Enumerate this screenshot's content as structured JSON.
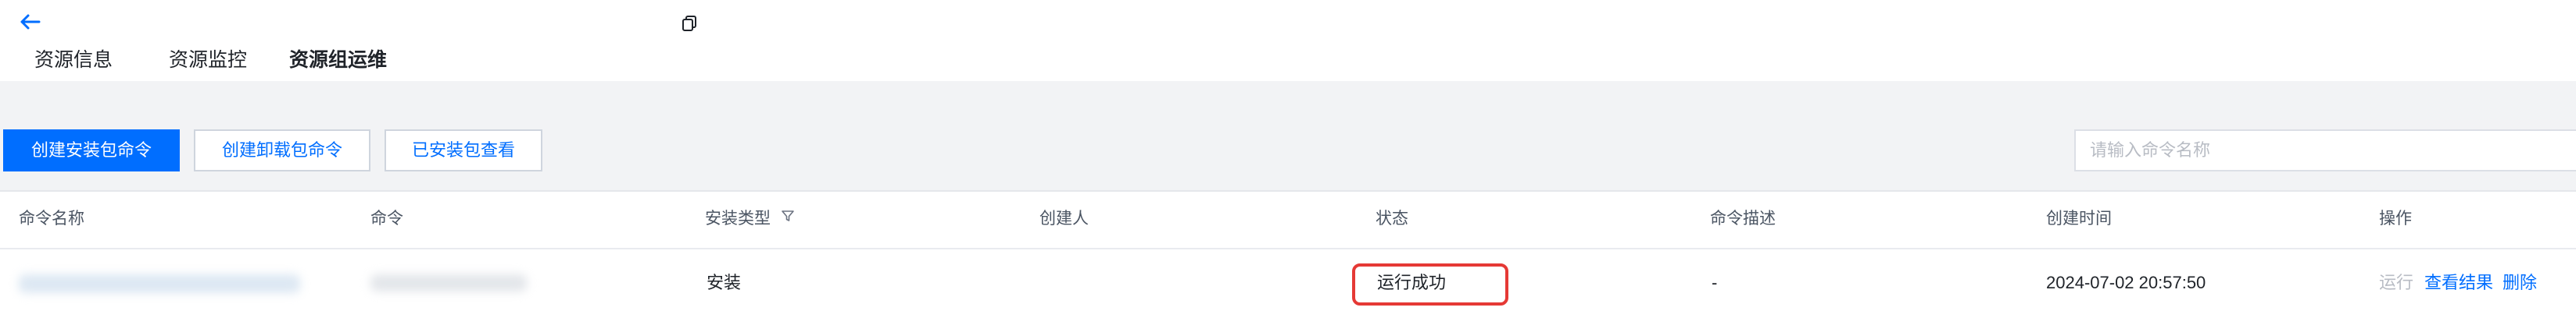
{
  "tabs": [
    "资源信息",
    "资源监控",
    "资源组运维"
  ],
  "toolbar": {
    "create_install": "创建安装包命令",
    "create_uninstall": "创建卸载包命令",
    "view_installed": "已安装包查看",
    "search_placeholder": "请输入命令名称"
  },
  "table": {
    "headers": [
      "命令名称",
      "命令",
      "安装类型",
      "创建人",
      "状态",
      "命令描述",
      "创建时间",
      "操作"
    ],
    "row": {
      "install_type": "安装",
      "status": "运行成功",
      "description": "-",
      "created_at": "2024-07-02 20:57:50"
    },
    "actions": [
      "运行",
      "查看结果",
      "删除"
    ]
  },
  "colors": {
    "primary": "#006eff",
    "highlight": "#e53935"
  }
}
